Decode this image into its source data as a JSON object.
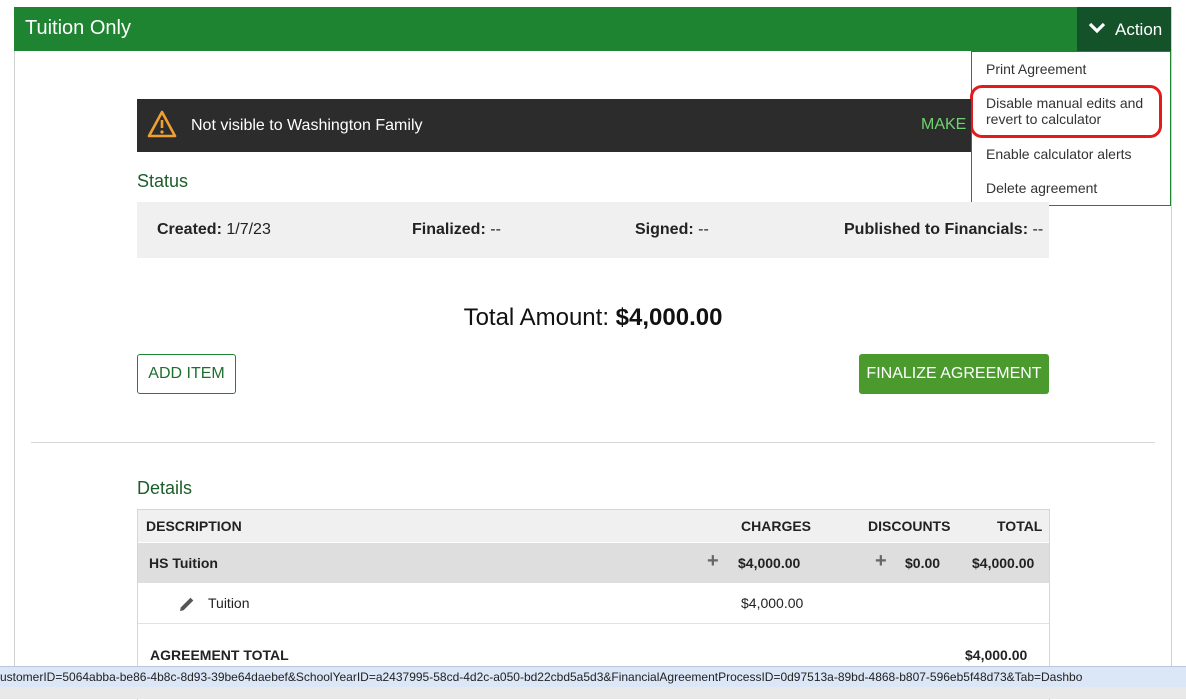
{
  "header": {
    "title": "Tuition Only",
    "action_label": "Action"
  },
  "action_menu": {
    "items": [
      "Print Agreement",
      "Disable manual edits and revert to calculator",
      "Enable calculator alerts",
      "Delete agreement"
    ],
    "item2_line1": "Disable manual edits and",
    "item2_line2": "revert to calculator"
  },
  "banner": {
    "text": "Not visible to Washington Family",
    "action": "MAKE"
  },
  "status": {
    "title": "Status",
    "created_label": "Created:",
    "created_value": "1/7/23",
    "finalized_label": "Finalized:",
    "finalized_value": "--",
    "signed_label": "Signed:",
    "signed_value": "--",
    "published_label": "Published to Financials:",
    "published_value": "--"
  },
  "total": {
    "label": "Total Amount:",
    "value": "$4,000.00"
  },
  "buttons": {
    "add_item": "ADD ITEM",
    "finalize": "FINALIZE AGREEMENT"
  },
  "details": {
    "title": "Details",
    "columns": [
      "DESCRIPTION",
      "CHARGES",
      "DISCOUNTS",
      "TOTAL"
    ],
    "group": {
      "description": "HS Tuition",
      "charges": "$4,000.00",
      "discounts": "$0.00",
      "total": "$4,000.00"
    },
    "item": {
      "description": "Tuition",
      "charges": "$4,000.00"
    },
    "agreement_total_label": "AGREEMENT TOTAL",
    "agreement_total_value": "$4,000.00"
  },
  "status_bar": {
    "url": "ustomerID=5064abba-be86-4b8c-8d93-39be64daebef&SchoolYearID=a2437995-58cd-4d2c-a050-bd22cbd5a5d3&FinancialAgreementProcessID=0d97513a-89bd-4868-b807-596eb5f48d73&Tab=Dashbo"
  },
  "colors": {
    "header_green": "#1e8432",
    "action_dark": "#14532a",
    "finalize_green": "#4a9a2e",
    "highlight_red": "#e31b1b",
    "banner_dark": "#2c2c2c"
  }
}
